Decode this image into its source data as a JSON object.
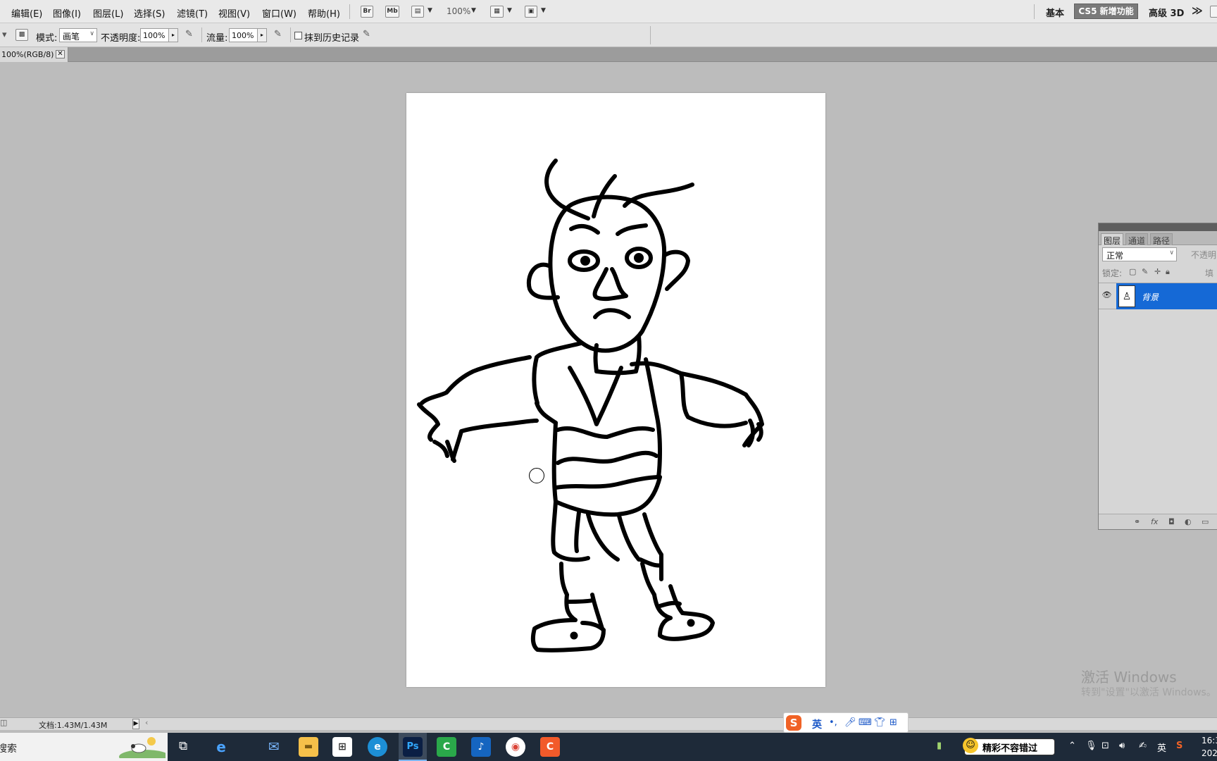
{
  "menubar": {
    "items": [
      "编辑(E)",
      "图像(I)",
      "图层(L)",
      "选择(S)",
      "滤镜(T)",
      "视图(V)",
      "窗口(W)",
      "帮助(H)"
    ],
    "bridge_label": "Br",
    "minibridge_label": "Mb",
    "zoom": "100%",
    "workspaces": {
      "basic": "基本",
      "new_features": "CS5 新增功能",
      "advanced_3d": "高级 3D",
      "more": "≫"
    }
  },
  "options": {
    "mode_label": "模式:",
    "mode_value": "画笔",
    "opacity_label": "不透明度:",
    "opacity_value": "100%",
    "flow_label": "流量:",
    "flow_value": "100%",
    "erase_history_label": "抹到历史记录"
  },
  "document": {
    "tab_label": "100%(RGB/8)",
    "close_glyph": "✕"
  },
  "layers_panel": {
    "tabs": [
      "图层",
      "通道",
      "路径"
    ],
    "blend_mode": "正常",
    "opacity_label": "不透明",
    "lock_label": "锁定:",
    "fill_label": "填",
    "layer_name": "背景"
  },
  "watermark": {
    "line1": "激活 Windows",
    "line2": "转到\"设置\"以激活 Windows。"
  },
  "statusbar": {
    "doc_info": "文档:1.43M/1.43M"
  },
  "ime": {
    "language": "英",
    "punct": "•,"
  },
  "taskbar": {
    "search_placeholder": "搜索",
    "news_text": "精彩不容错过",
    "tray_language": "英",
    "clock_time": "16:3",
    "clock_date": "202"
  }
}
